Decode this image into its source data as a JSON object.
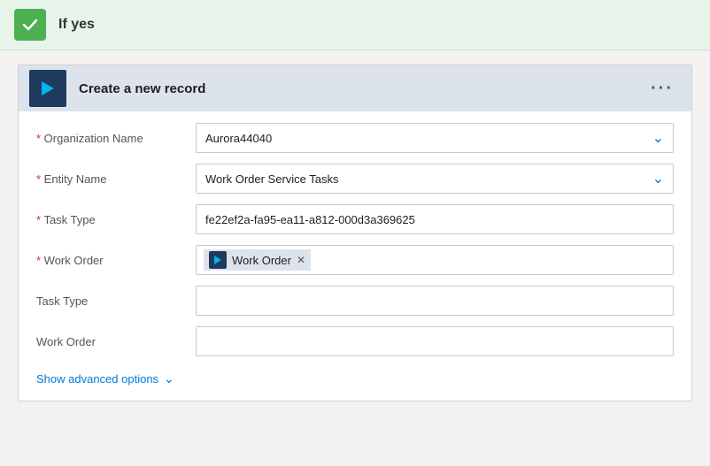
{
  "header": {
    "title": "If yes",
    "check_color": "#4caf50"
  },
  "card": {
    "title": "Create a new record",
    "menu_label": "···",
    "fields": {
      "org_label": "Organization Name",
      "org_value": "Aurora44040",
      "entity_label": "Entity Name",
      "entity_value": "Work Order Service Tasks",
      "task_type_label": "Task Type",
      "task_type_value": "fe22ef2a-fa95-ea11-a812-000d3a369625",
      "work_order_label": "Work Order",
      "work_order_tag": "Work Order",
      "task_type2_label": "Task Type",
      "work_order2_label": "Work Order"
    },
    "advanced_label": "Show advanced options"
  }
}
